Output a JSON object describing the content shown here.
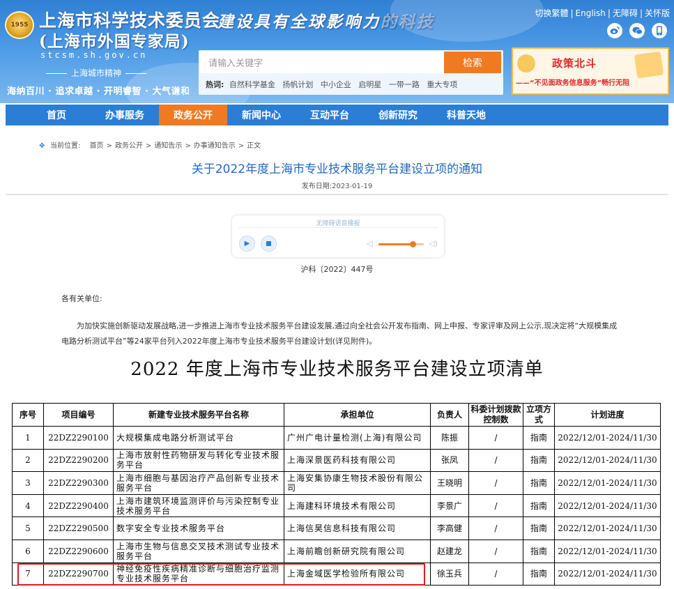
{
  "header": {
    "emblem_text": "1955",
    "org_name": "上海市科学技术委员会",
    "org_sub": "(上海市外国专家局)",
    "domain": "stcsm.sh.gov.cn",
    "spirit_title": "上海城市精神",
    "spirit_text": "海纳百川 · 追求卓越 · 开明睿智 · 大气谦和",
    "slogan": "建设具有全球影响力",
    "slogan_faded": "的科技",
    "top_links": [
      "切换繁體",
      "English",
      "无障碍",
      "关怀版"
    ],
    "social_icons": [
      "weibo-icon",
      "wechat-icon",
      "mobile-icon"
    ]
  },
  "search": {
    "placeholder": "请输入关键字",
    "button": "检索",
    "hot_label": "热词:",
    "hot_terms": [
      "自然科学基金",
      "扬帆计划",
      "中小企业",
      "启明星",
      "一带一路",
      "重大专项"
    ]
  },
  "banner": {
    "title": "政策北斗",
    "subtitle": "——“不见面政务信息服务”畅行无阻"
  },
  "nav": {
    "items": [
      "首页",
      "办事服务",
      "政务公开",
      "新闻中心",
      "互动平台",
      "创新研究",
      "科普天地"
    ],
    "active": "政务公开"
  },
  "breadcrumb": {
    "label": "当前位置:",
    "items": [
      "首页",
      "政务公开",
      "通知告示",
      "办事通知告示",
      "正文"
    ]
  },
  "article": {
    "title": "关于2022年度上海市专业技术服务平台建设立项的通知",
    "date": "发布日期:2023-01-19",
    "doc_no": "沪科〔2022〕447号",
    "salutation": "各有关单位:",
    "paragraph": "为加快实施创新驱动发展战略,进一步推进上海市专业技术服务平台建设发展,通过向全社会公开发布指南、网上申报、专家评审及网上公示,现决定将“大规模集成电路分析测试平台”等24家平台列入2022年度上海市专业技术服务平台建设计划(详见附件)。"
  },
  "player": {
    "label": "无障碍语音播报",
    "volume": 0.75
  },
  "project_list": {
    "title": "2022 年度上海市专业技术服务平台建设立项清单",
    "columns": [
      "序号",
      "项目编号",
      "新建专业技术服务平台名称",
      "承担单位",
      "负责人",
      "科委计划拨款控制数",
      "立项方式",
      "计划进度"
    ],
    "rows": [
      [
        "1",
        "22DZ2290100",
        "大规模集成电路分析测试平台",
        "广州广电计量检测(上海)有限公司",
        "陈振",
        "/",
        "指南",
        "2022/12/01-2024/11/30"
      ],
      [
        "2",
        "22DZ2290200",
        "上海市放射性药物研发与转化专业技术服务平台",
        "上海深景医药科技有限公司",
        "张凤",
        "/",
        "指南",
        "2022/12/01-2024/11/30"
      ],
      [
        "3",
        "22DZ2290300",
        "上海市细胞与基因治疗产品创新专业技术服务平台",
        "上海安集协康生物技术股份有限公司",
        "王晓明",
        "/",
        "指南",
        "2022/12/01-2024/11/30"
      ],
      [
        "4",
        "22DZ2290400",
        "上海市建筑环境监测评价与污染控制专业技术服务平台",
        "上海建科环境技术有限公司",
        "李景广",
        "/",
        "指南",
        "2022/12/01-2024/11/30"
      ],
      [
        "5",
        "22DZ2290500",
        "数字安全专业技术服务平台",
        "上海信昊信息科技有限公司",
        "李高健",
        "/",
        "指南",
        "2022/12/01-2024/11/30"
      ],
      [
        "6",
        "22DZ2290600",
        "上海市生物与信息交叉技术测试专业技术服务平台",
        "上海前瞻创新研究院有限公司",
        "赵建龙",
        "/",
        "指南",
        "2022/12/01-2024/11/30"
      ],
      [
        "7",
        "22DZ2290700",
        "神经免疫性疾病精准诊断与细胞治疗监测专业技术服务平台",
        "上海金域医学检验所有限公司",
        "徐玉兵",
        "/",
        "指南",
        "2022/12/01-2024/11/30"
      ]
    ],
    "highlight_color": "#e11b1b"
  },
  "colors": {
    "header_blue": "#2f7fd4",
    "nav_blue": "#2a7ed6",
    "accent_orange": "#f07a22",
    "title_blue": "#2268c0"
  }
}
